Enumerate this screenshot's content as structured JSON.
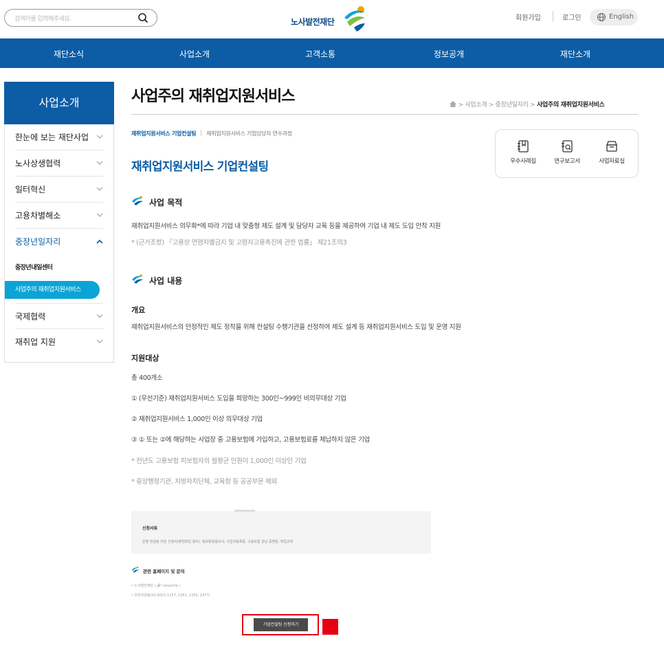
{
  "header": {
    "search_placeholder": "검색어를 입력해주세요.",
    "logo_text": "노사발전재단",
    "join_label": "회원가입",
    "login_label": "로그인",
    "lang_label": "English"
  },
  "gnb": [
    "재단소식",
    "사업소개",
    "고객소통",
    "정보공개",
    "재단소개"
  ],
  "sidebar": {
    "title": "사업소개",
    "items": [
      {
        "label": "한눈에 보는 재단사업"
      },
      {
        "label": "노사상생협력"
      },
      {
        "label": "일터혁신"
      },
      {
        "label": "고용차별해소"
      },
      {
        "label": "중장년일자리"
      },
      {
        "label": "국제협력"
      },
      {
        "label": "재취업 지원"
      }
    ],
    "subitems": [
      "중장년내일센터",
      "사업주의 재취업지원서비스"
    ]
  },
  "main": {
    "page_title": "사업주의 재취업지원서비스",
    "breadcrumb": {
      "b1": "사업소개",
      "b2": "중장년일자리",
      "current": "사업주의 재취업지원서비스",
      "sep": ">"
    },
    "subtabs": {
      "active": "재취업지원서비스 기업컨설팅",
      "other": "재취업지원서비스 기업담당자 연수과정"
    },
    "section_title": "재취업지원서비스 기업컨설팅",
    "quick": [
      "우수사례집",
      "연구보고서",
      "사업자료실"
    ],
    "purpose": {
      "heading": "사업 목적",
      "text": "재취업지원서비스 의무화*에 따라 기업 내 맞춤형 제도 설계 및 담당자 교육 등을 제공하여 기업 내 제도 도입 안착 지원",
      "note": "* (근거조항) 「고용상 연령차별금지 및 고령자고용촉진에 관한 법률」 제21조의3"
    },
    "content": {
      "heading": "사업 내용",
      "overview_title": "개요",
      "overview_text": "재취업지원서비스의 안정적인 제도 정착을 위해 컨설팅 수행기관을 선정하여 제도 설계 등 재취업지원서비스 도입 및 운영 지원",
      "target_title": "지원대상",
      "target_total": "총 400개소",
      "targets": [
        "① (우선기준) 재취업지원서비스 도입을 희망하는 300인~999인 비의무대상 기업",
        "② 재취업지원서비스 1,000인 이상 의무대상 기업",
        "③ ① 또는 ②에 해당하는 사업장 중 고용보험에 가입하고, 고용보험료를 체납하지 않은 기업"
      ],
      "notes": [
        "* 전년도 고용보험 피보험자의 월평균 인원이 1,000인 이상인 기업",
        "* 중앙행정기관, 지방자치단체, 교육청 등 공공부문 제외"
      ]
    },
    "embed": {
      "docs_title": "신청서류",
      "docs_text": "운영 컨설팅 지원 신청서(붙임파일 참조), 정보활용동의서, 사업자등록증, 고용보험 완납 증명원, 취업규칙",
      "related_title": "관련 홈페이지 및 문의",
      "related_items": [
        "• 노사발전재단 ( 🔗 nosaonle )",
        "• 전직지원팀(02-6021-1257, 1261, 1332, 1477)"
      ],
      "apply_label": "기업컨설팅 신청하기"
    }
  },
  "colors": {
    "brand": "#0c5da5",
    "accent": "#0ba4d6",
    "highlight": "#e60012"
  }
}
